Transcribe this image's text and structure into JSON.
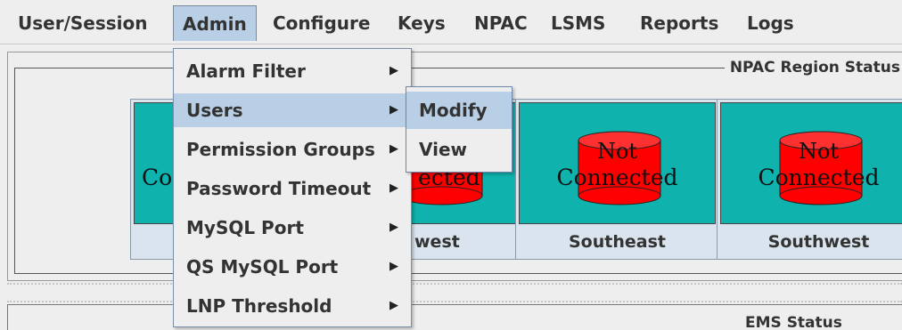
{
  "menubar": {
    "items": [
      {
        "label": "User/Session"
      },
      {
        "label": "Admin"
      },
      {
        "label": "Configure"
      },
      {
        "label": "Keys"
      },
      {
        "label": "NPAC"
      },
      {
        "label": "LSMS"
      },
      {
        "label": "Reports"
      },
      {
        "label": "Logs"
      }
    ],
    "active": "Admin"
  },
  "npac_panel": {
    "title": "NPAC Region Status",
    "regions": [
      {
        "name": "",
        "status": "Co"
      },
      {
        "name": "west",
        "status": "ected"
      },
      {
        "name": "Southeast",
        "status_top": "Not",
        "status": "Connected"
      },
      {
        "name": "Southwest",
        "status_top": "Not",
        "status": "Connected"
      }
    ]
  },
  "ems_panel": {
    "title": "EMS Status"
  },
  "admin_menu": {
    "items": [
      {
        "label": "Alarm Filter",
        "has_submenu": true
      },
      {
        "label": "Users",
        "has_submenu": true
      },
      {
        "label": "Permission Groups",
        "has_submenu": true
      },
      {
        "label": "Password Timeout",
        "has_submenu": true
      },
      {
        "label": "MySQL Port",
        "has_submenu": true
      },
      {
        "label": "QS MySQL Port",
        "has_submenu": true
      },
      {
        "label": "LNP Threshold",
        "has_submenu": true
      }
    ],
    "highlighted": "Users"
  },
  "users_submenu": {
    "items": [
      {
        "label": "Modify"
      },
      {
        "label": "View"
      }
    ],
    "highlighted": "Modify"
  },
  "colors": {
    "tile": "#0fb2ad",
    "cylinder": "#ff0000",
    "highlight": "#b8cfe5"
  }
}
